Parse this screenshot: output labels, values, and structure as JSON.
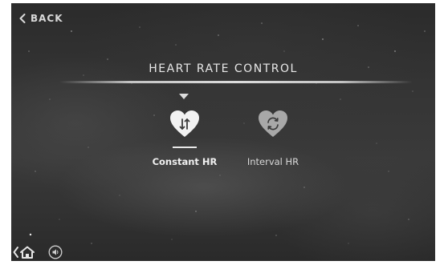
{
  "header": {
    "back_label": "BACK"
  },
  "main": {
    "title": "HEART RATE CONTROL",
    "options": [
      {
        "label": "Constant HR",
        "icon": "heart-arrows-icon",
        "selected": true
      },
      {
        "label": "Interval HR",
        "icon": "heart-cycle-icon",
        "selected": false
      }
    ]
  },
  "footer": {
    "home_icon": "home-icon",
    "sound_icon": "speaker-icon"
  },
  "colors": {
    "background": "#333333",
    "text": "#e6e6e6",
    "selected_heart": "#f2f2f2",
    "unselected_heart": "#a8a8a8"
  }
}
